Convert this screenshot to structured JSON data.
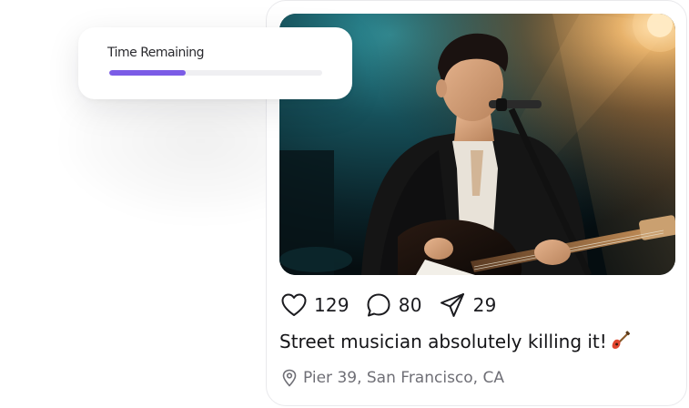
{
  "timer": {
    "label": "Time Remaining",
    "progress_fraction": 0.36,
    "accent_color": "#7b5ce6"
  },
  "post": {
    "image": {
      "subject_icon": "musician-photo"
    },
    "actions": [
      {
        "icon": "heart-icon",
        "count": "129"
      },
      {
        "icon": "comment-icon",
        "count": "80"
      },
      {
        "icon": "send-icon",
        "count": "29"
      }
    ],
    "caption": "Street musician absolutely killing it!",
    "caption_emoji": "guitar-emoji",
    "location": {
      "icon": "location-pin-icon",
      "text": "Pier 39, San Francisco, CA"
    }
  }
}
